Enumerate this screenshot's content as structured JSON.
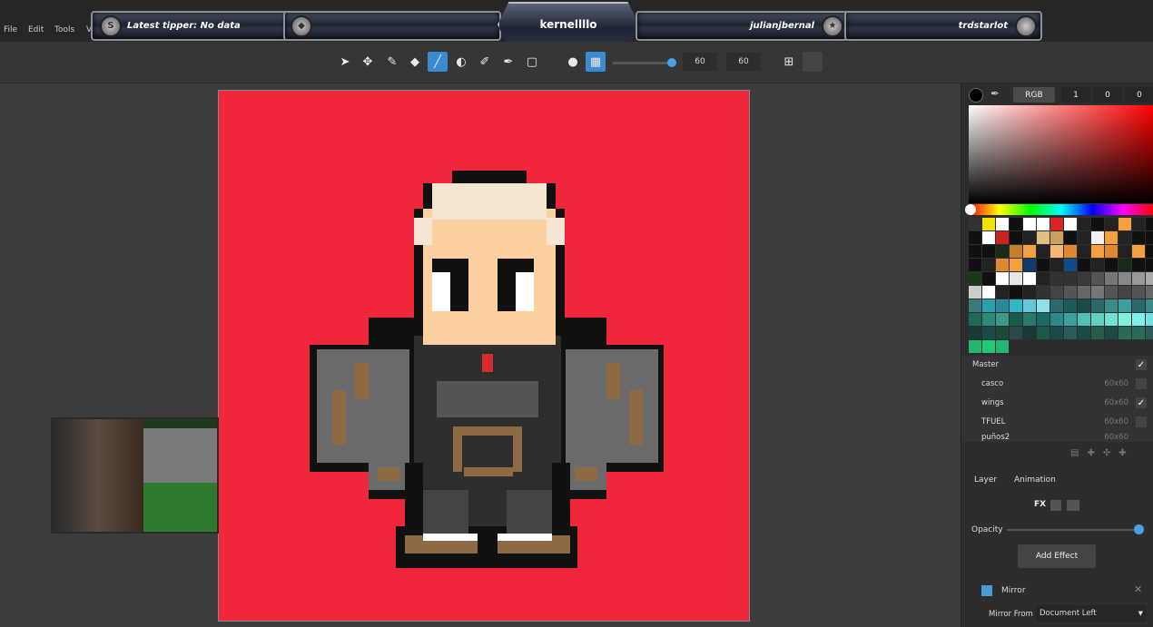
{
  "overlay": {
    "latest_tipper": "Latest tipper: No data",
    "center_name": "kernellllo",
    "right_name_1": "julianjbernal",
    "right_name_2": "trdstarlot",
    "medal_left": "S"
  },
  "menu": {
    "file": "File",
    "edit": "Edit",
    "tools": "Tools",
    "more": "V"
  },
  "toolbar": {
    "size_value": "60",
    "size_value_2": "60",
    "size_fraction": 0.93
  },
  "color_panel": {
    "mode_label": "RGB",
    "r": "1",
    "g": "0",
    "b": "0"
  },
  "palette_colors": [
    "#333",
    "#f2e300",
    "#fff",
    "#111",
    "#fff",
    "#fff",
    "#d22",
    "#fff",
    "#222",
    "#111",
    "#222",
    "#f4a040",
    "#222",
    "#111",
    "#111",
    "#fff",
    "#c22",
    "#111",
    "#222",
    "#e0c080",
    "#c8a060",
    "#111",
    "#222",
    "#f0f0f0",
    "#f4a040",
    "#222",
    "#111",
    "#111",
    "#111",
    "#111",
    "#1a2a1a",
    "#c08030",
    "#f4a040",
    "#222",
    "#f4b870",
    "#e08830",
    "#222",
    "#f4a040",
    "#e08830",
    "#222",
    "#f4a040",
    "#111",
    "#111",
    "#222",
    "#e08830",
    "#f4a040",
    "#123a6a",
    "#111",
    "#222",
    "#124a8a",
    "#111",
    "#222",
    "#111",
    "#1a2a1a",
    "#111",
    "#111",
    "#1a3a1a",
    "#111",
    "#fff",
    "#e8e8e8",
    "#fff",
    "#222",
    "#333",
    "#333",
    "#3a3a3a",
    "#555",
    "#777",
    "#888",
    "#999",
    "#aaa",
    "#ccc",
    "#fff",
    "#222",
    "#111",
    "#222",
    "#333",
    "#444",
    "#555",
    "#666",
    "#777",
    "#555",
    "#444",
    "#555",
    "#666",
    "#3a7a7a",
    "#2aa0b0",
    "#2a8a9a",
    "#30b8c8",
    "#60c8d8",
    "#90e0e8",
    "#2a6a6a",
    "#1a5a5a",
    "#1a4a4a",
    "#2a6a6a",
    "#3a8a8a",
    "#3aa0a0",
    "#2a6a6a",
    "#3a8a8a",
    "#1a6a5a",
    "#2a8a7a",
    "#3a9a8a",
    "#1a5a4a",
    "#2a7a6a",
    "#1a6a6a",
    "#2a8a8a",
    "#3aa0a0",
    "#50c0b0",
    "#60d0c0",
    "#70e0d0",
    "#80f0e0",
    "#80f0f0",
    "#70e0e0",
    "#1a3a3a",
    "#1a4a4a",
    "#1a4a3a",
    "#2a4a4a",
    "#1a3a3a",
    "#1a5a4a",
    "#1a4a4a",
    "#2a5a5a",
    "#1a4a4a",
    "#2a5a4a",
    "#1a4a4a",
    "#2a6a5a",
    "#2a6a5a",
    "#2a5a5a",
    "#20b870",
    "#20c878",
    "#20b870"
  ],
  "layers": {
    "master": "Master",
    "items": [
      {
        "name": "casco",
        "size": "60x60"
      },
      {
        "name": "wings",
        "size": "60x60"
      },
      {
        "name": "TFUEL",
        "size": "60x60"
      },
      {
        "name": "puños2",
        "size": "60x60"
      }
    ]
  },
  "panel_tabs": {
    "layer": "Layer",
    "animation": "Animation"
  },
  "effects": {
    "fx_label": "FX",
    "opacity_label": "Opacity",
    "opacity_value": 1.0,
    "add_effect": "Add Effect",
    "mirror_label": "Mirror",
    "mirror_from_label": "Mirror From",
    "mirror_from_value": "Document Left"
  },
  "colors": {
    "canvas_bg": "#f0273a",
    "accent": "#3b8bd2"
  }
}
